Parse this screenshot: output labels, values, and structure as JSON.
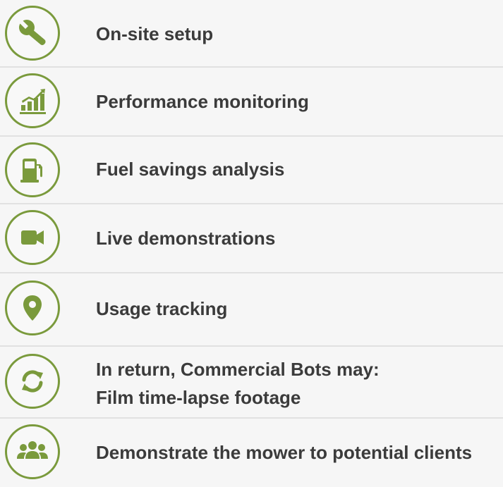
{
  "colors": {
    "accent": "#7a9a3c",
    "background": "#f6f6f6",
    "text": "#3b3b3b",
    "divider": "#e1e1e1"
  },
  "items": [
    {
      "label": "On-site setup",
      "icon": "wrench-icon"
    },
    {
      "label": "Performance monitoring",
      "icon": "bar-chart-icon"
    },
    {
      "label": "Fuel savings analysis",
      "icon": "fuel-pump-icon"
    },
    {
      "label": "Live demonstrations",
      "icon": "video-camera-icon"
    },
    {
      "label": "Usage tracking",
      "icon": "map-pin-icon"
    },
    {
      "line1": "In return, Commercial Bots may:",
      "line2": "Film time-lapse footage",
      "icon": "refresh-icon"
    },
    {
      "label": "Demonstrate the mower to potential clients",
      "icon": "users-icon"
    }
  ]
}
